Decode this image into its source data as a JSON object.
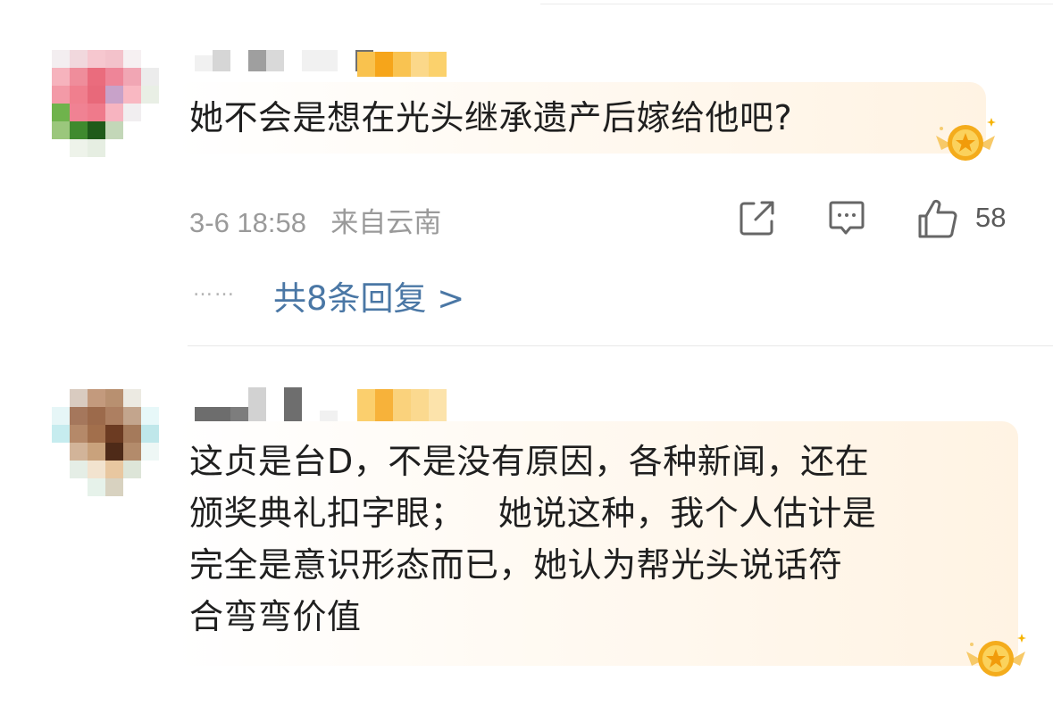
{
  "comments": [
    {
      "text": "她不会是想在光头继承遗产后嫁给他吧?",
      "time": "3-6 18:58",
      "location": "来自云南",
      "like_count": "58",
      "replies_label": "共8条回复 >",
      "reply_dots": "……"
    },
    {
      "text_lines": [
        "这贞是台D，不是没有原因，各种新闻，还在",
        "颁奖典礼扣字眼；   她说这种，我个人估计是",
        "完全是意识形态而已，她认为帮光头说话符",
        "合弯弯价值"
      ]
    }
  ],
  "icons": {
    "share": "share-icon",
    "comment": "comment-icon",
    "like": "thumbs-up-icon",
    "badge": "gold-crown-badge-icon"
  },
  "colors": {
    "link": "#4a77a5",
    "meta": "#9a9a9a",
    "badge_gold": "#f6b300"
  }
}
